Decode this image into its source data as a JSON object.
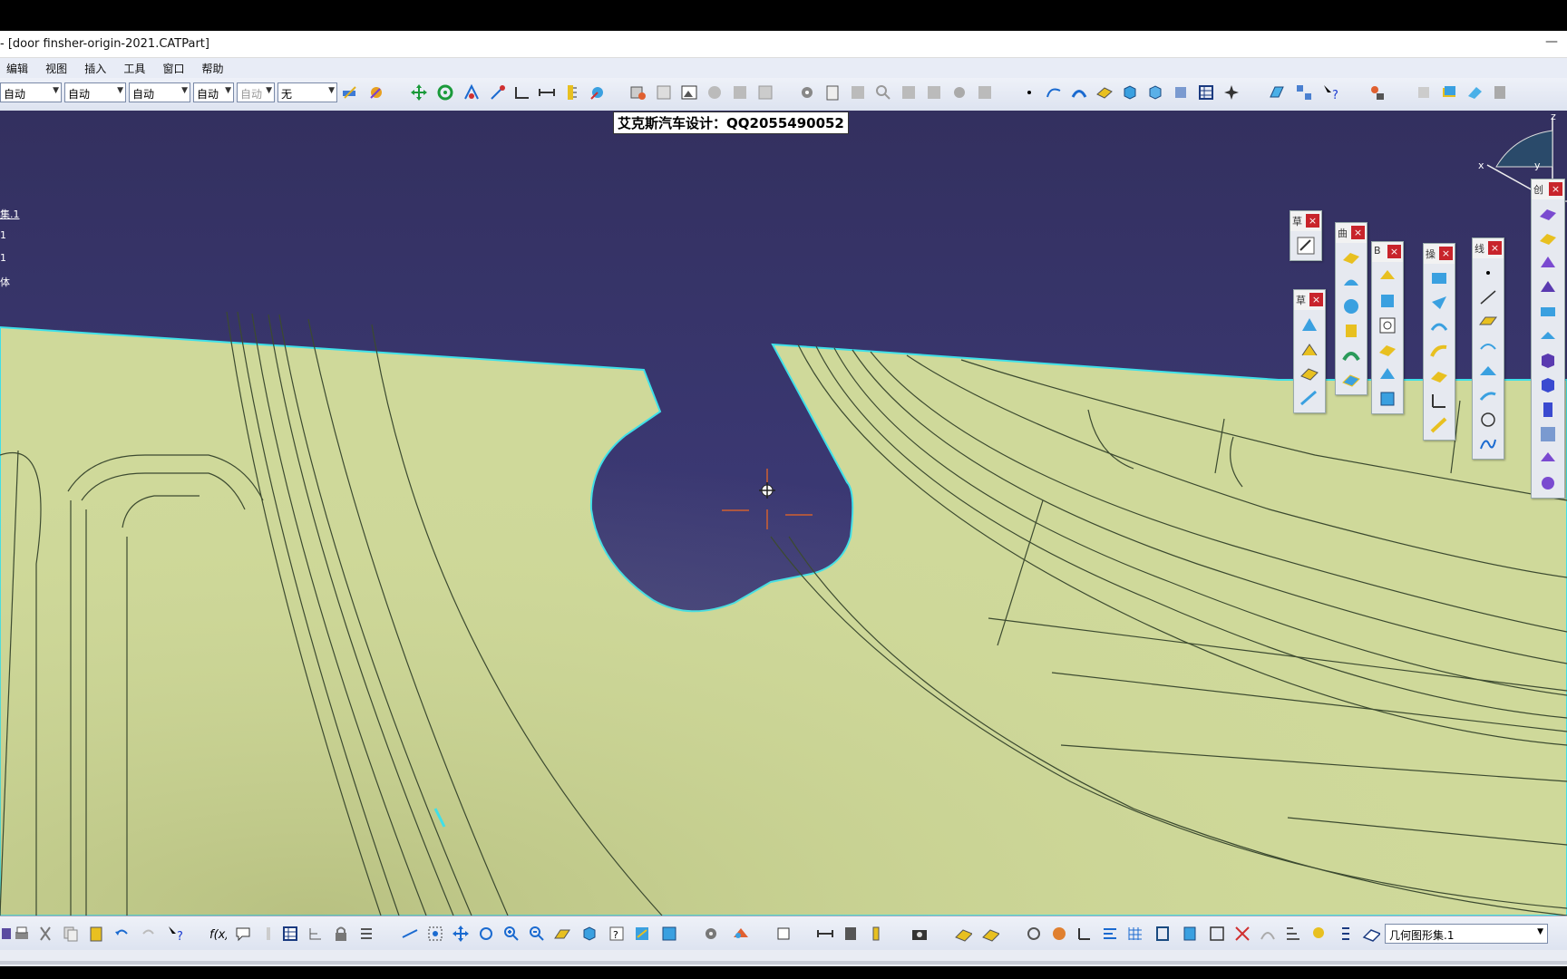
{
  "window": {
    "title": "- [door finsher-origin-2021.CATPart]",
    "minimize_glyph": "—"
  },
  "menu": [
    "编辑",
    "视图",
    "插入",
    "工具",
    "窗口",
    "帮助"
  ],
  "toolbar": {
    "selects": [
      {
        "value": "自动"
      },
      {
        "value": "自动"
      },
      {
        "value": "自动"
      },
      {
        "value": "自动"
      },
      {
        "value": "自动"
      },
      {
        "value": "无"
      }
    ]
  },
  "watermark": "艾克斯汽车设计：QQ2055490052",
  "tree": [
    "集.1",
    "1",
    "1",
    "体"
  ],
  "compass": {
    "x_label": "x",
    "y_label": "y",
    "z_label": "z"
  },
  "palettes": [
    {
      "title": "草",
      "icons": [
        "sketch-icon"
      ]
    },
    {
      "title": "曲",
      "icons": [
        "extrude-icon",
        "revolve-icon",
        "sphere-icon",
        "cylinder-icon",
        "sweep-icon",
        "fill-icon"
      ]
    },
    {
      "title": "B",
      "icons": [
        "blend-icon",
        "offset-icon",
        "split-icon",
        "trim-icon",
        "boundary-icon",
        "extract-icon"
      ]
    },
    {
      "title": "操",
      "icons": [
        "join-icon",
        "healing-icon",
        "fillet-icon",
        "chamfer-icon",
        "translate-icon",
        "rotate-icon",
        "symmetry-icon"
      ]
    },
    {
      "title": "线",
      "icons": [
        "point-icon",
        "line-icon",
        "plane-icon",
        "projection-icon",
        "intersection-icon",
        "corner-icon",
        "circle-icon",
        "spline-icon"
      ]
    },
    {
      "title": "创",
      "icons": [
        "pad-icon",
        "pocket-icon",
        "shaft-icon",
        "groove-icon",
        "hole-icon",
        "rib-icon",
        "slot-icon",
        "stiffener-icon",
        "loft-icon",
        "remove-icon",
        "thick-icon",
        "draft-icon"
      ]
    },
    {
      "title": "草",
      "icons": [
        "positioned-sketch-icon",
        "axis-system-icon",
        "plane-system-icon",
        "datum-icon"
      ]
    }
  ],
  "bottom": {
    "geometric_set": "几何图形集.1"
  },
  "colors": {
    "background": "#3a3870",
    "surface": "#cfd99a",
    "edge_highlight": "#3fe0e8"
  }
}
